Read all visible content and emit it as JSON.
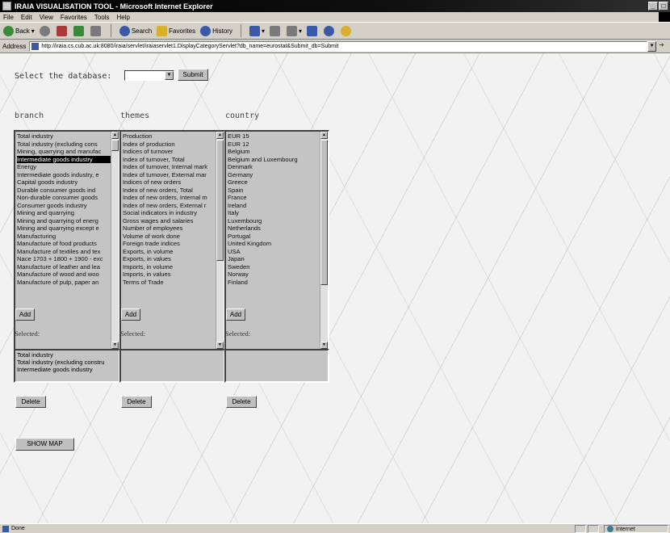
{
  "window": {
    "title": "IRAIA VISUALISATION TOOL - Microsoft Internet Explorer"
  },
  "menu": [
    "File",
    "Edit",
    "View",
    "Favorites",
    "Tools",
    "Help"
  ],
  "toolbar": {
    "back": "Back",
    "search": "Search",
    "favorites": "Favorites",
    "history": "History"
  },
  "address": {
    "label": "Address",
    "url": "http://iraia.cs.cub.ac.uk:8080/iraia/servlet/iraiaservlet1.DisplayCategoryServlet?db_name=eurostat&Submit_db=Submit"
  },
  "db_select": {
    "label": "Select the database:",
    "value": "",
    "submit_label": "Submit"
  },
  "columns": [
    {
      "header": "branch",
      "items": [
        "Total industry",
        "Total industry (excluding cons",
        "Mining, quarrying and manufac",
        "Intermediate goods industry",
        "Energy",
        "Intermediate goods industry, e",
        "Capital goods industry",
        "Durable consumer goods ind",
        "Non-durable consumer goods",
        "Consumer goods industry",
        "Mining and quarrying",
        "Mining and quarrying of energ",
        "Mining and quarrying except e",
        "Manufacturing",
        "Manufacture of food products",
        "Manufacture of textiles and tex",
        "Nace 1703 + 1800 + 1900 - exc",
        "Manufacture of leather and lea",
        "Manufacture of wood and woo",
        "Manufacture of pulp, paper an"
      ],
      "selected_index": 3,
      "add_label": "Add",
      "selected_label": "Selected:",
      "selected_items": [
        "Total industry",
        "Total industry (excluding constru",
        "Intermediate goods industry"
      ],
      "delete_label": "Delete"
    },
    {
      "header": "themes",
      "items": [
        "Production",
        "Index of production",
        "Indices of turnover",
        "Index of turnover, Total",
        "Index of turnover, Internal mark",
        "Index of turnover, External mar",
        "Indices of new orders",
        "Index of new orders, Total",
        "Index of new orders, Internal m",
        "Index of new orders, External r",
        "Social indicators in industry",
        "Gross wages and salaries",
        "Number of employees",
        "Volume of work done",
        "Foreign trade indices",
        "Exports, in volume",
        "Exports, in values",
        "Imports, in volume",
        "Imports, in values",
        "Terms of Trade"
      ],
      "selected_index": -1,
      "add_label": "Add",
      "selected_label": "Selected:",
      "selected_items": [],
      "delete_label": "Delete"
    },
    {
      "header": "country",
      "items": [
        "EUR 15",
        "EUR 12",
        "Belgium",
        "Belgium and Luxembourg",
        "Denmark",
        "Germany",
        "Greece",
        "Spain",
        "France",
        "Ireland",
        "Italy",
        "Luxembourg",
        "Netherlands",
        "Portugal",
        "United Kingdom",
        "USA",
        "Japan",
        "Sweden",
        "Norway",
        "Finland"
      ],
      "selected_index": -1,
      "add_label": "Add",
      "selected_label": "Selected:",
      "selected_items": [],
      "delete_label": "Delete"
    }
  ],
  "show_map_label": "SHOW MAP",
  "status": {
    "text": "Done",
    "zone": "Internet"
  }
}
